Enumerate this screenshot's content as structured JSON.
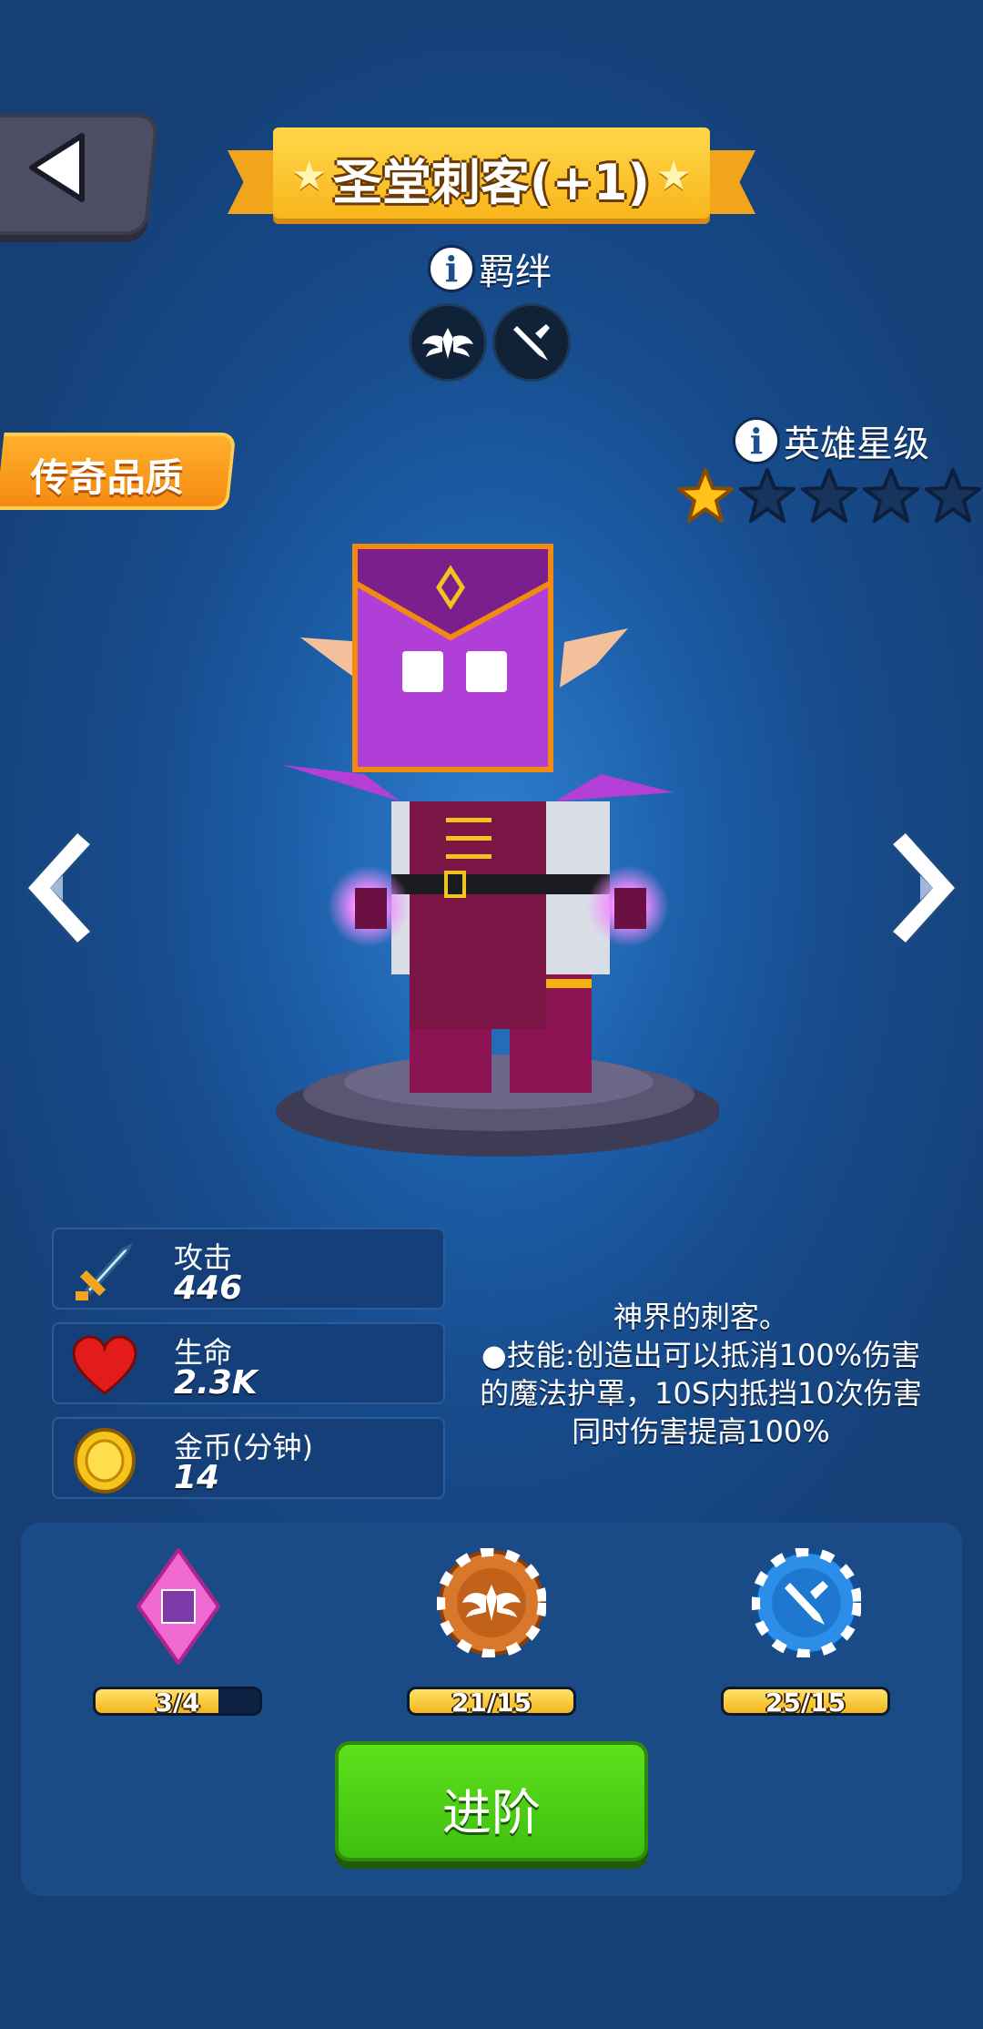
{
  "header": {
    "title": "圣堂刺客(+1)"
  },
  "bond": {
    "label": "羁绊",
    "icons": [
      "winged-emblem-icon",
      "dagger-icon"
    ]
  },
  "quality": {
    "label": "传奇品质"
  },
  "hero_star": {
    "label": "英雄星级",
    "filled": 1,
    "total": 5
  },
  "stats": [
    {
      "icon": "sword-icon",
      "name": "攻击",
      "value": "446"
    },
    {
      "icon": "heart-icon",
      "name": "生命",
      "value": "2.3K"
    },
    {
      "icon": "gold-coin-icon",
      "name": "金币(分钟)",
      "value": "14"
    }
  ],
  "description": {
    "line1": "神界的刺客。",
    "line2": "●技能:创造出可以抵消100%伤害的魔法护罩，10S内抵挡10次伤害同时伤害提高100%"
  },
  "materials": [
    {
      "icon": "hero-shard-icon",
      "progress": "3/4",
      "fraction": 0.75
    },
    {
      "icon": "winged-emblem-chip-icon",
      "progress": "21/15",
      "fraction": 1.0
    },
    {
      "icon": "dagger-chip-icon",
      "progress": "25/15",
      "fraction": 1.0
    }
  ],
  "actions": {
    "advance_label": "进阶"
  },
  "colors": {
    "accent_gold": "#f9b51c",
    "advance_green": "#4fd214",
    "quality_orange": "#f48b10"
  }
}
